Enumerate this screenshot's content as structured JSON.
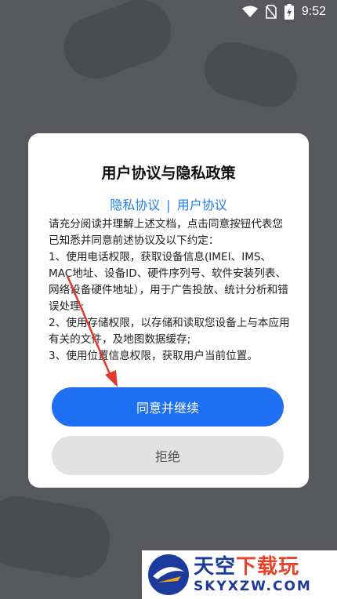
{
  "status_bar": {
    "time": "9:52"
  },
  "dialog": {
    "title": "用户协议与隐私政策",
    "links": {
      "privacy": "隐私协议",
      "separator": "|",
      "user": "用户协议"
    },
    "body_lines": [
      "请充分阅读并理解上述文档，点击同意按钮代表您已知悉并同意前述协议及以下约定：",
      "1、使用电话权限，获取设备信息(IMEI、IMS、MAC地址、设备ID、硬件序列号、软件安装列表、网络设备硬件地址），用于广告投放、统计分析和错误处理;",
      "2、使用存储权限，以存储和读取您设备上与本应用有关的文件，及地图数据缓存;",
      "3、使用位置信息权限，获取用户当前位置。"
    ],
    "agree_label": "同意并继续",
    "reject_label": "拒绝"
  },
  "watermark": {
    "name_main": "天空",
    "name_accent": "下载玩",
    "domain": "SKYXZW.COM"
  },
  "colors": {
    "accent": "#1f6ff2",
    "link": "#1e7ee8",
    "annotation_arrow": "#e23a2c"
  }
}
